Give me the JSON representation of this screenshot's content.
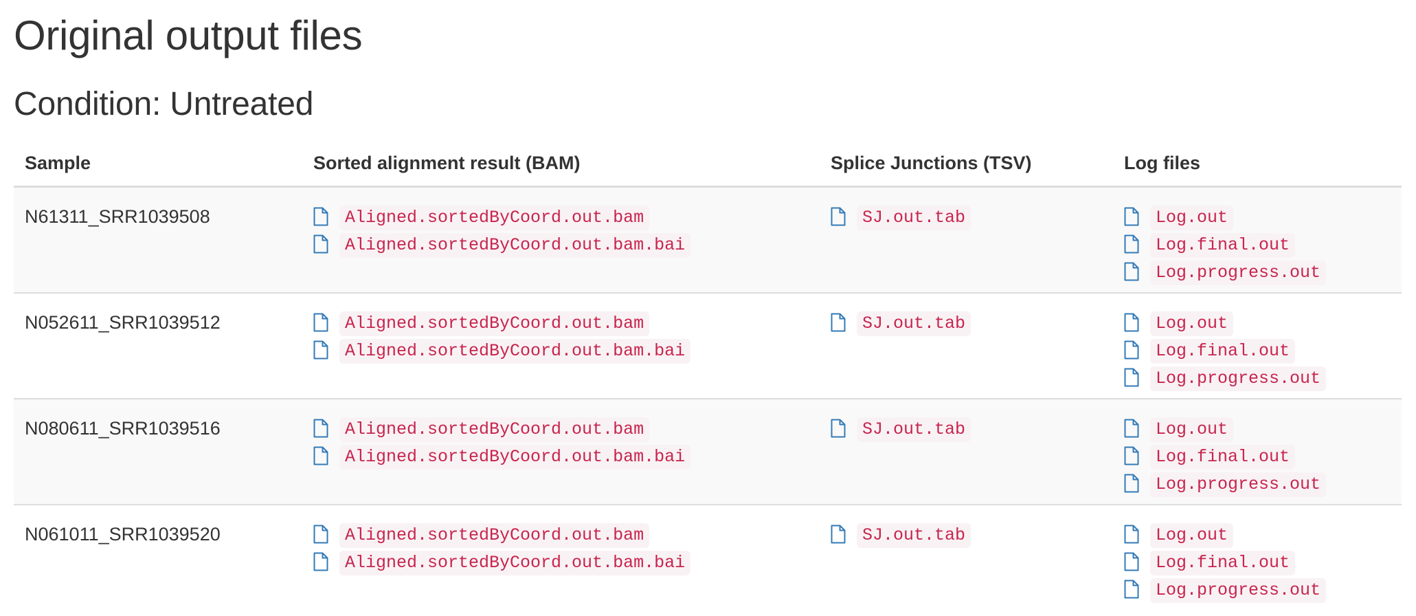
{
  "page": {
    "title": "Original output files",
    "condition_heading": "Condition: Untreated"
  },
  "table": {
    "headers": {
      "sample": "Sample",
      "bam": "Sorted alignment result (BAM)",
      "sj": "Splice Junctions (TSV)",
      "log": "Log files"
    },
    "rows": [
      {
        "sample": "N61311_SRR1039508",
        "bam": [
          "Aligned.sortedByCoord.out.bam",
          "Aligned.sortedByCoord.out.bam.bai"
        ],
        "sj": [
          "SJ.out.tab"
        ],
        "log": [
          "Log.out",
          "Log.final.out",
          "Log.progress.out"
        ]
      },
      {
        "sample": "N052611_SRR1039512",
        "bam": [
          "Aligned.sortedByCoord.out.bam",
          "Aligned.sortedByCoord.out.bam.bai"
        ],
        "sj": [
          "SJ.out.tab"
        ],
        "log": [
          "Log.out",
          "Log.final.out",
          "Log.progress.out"
        ]
      },
      {
        "sample": "N080611_SRR1039516",
        "bam": [
          "Aligned.sortedByCoord.out.bam",
          "Aligned.sortedByCoord.out.bam.bai"
        ],
        "sj": [
          "SJ.out.tab"
        ],
        "log": [
          "Log.out",
          "Log.final.out",
          "Log.progress.out"
        ]
      },
      {
        "sample": "N061011_SRR1039520",
        "bam": [
          "Aligned.sortedByCoord.out.bam",
          "Aligned.sortedByCoord.out.bam.bai"
        ],
        "sj": [
          "SJ.out.tab"
        ],
        "log": [
          "Log.out",
          "Log.final.out",
          "Log.progress.out"
        ]
      }
    ]
  },
  "icons": {
    "file": "file-icon"
  },
  "colors": {
    "link_code_text": "#c7254e",
    "link_code_bg": "#f9f2f4",
    "icon_stroke": "#337ab7",
    "row_stripe": "#f9f9f9",
    "border": "#dddddd"
  }
}
